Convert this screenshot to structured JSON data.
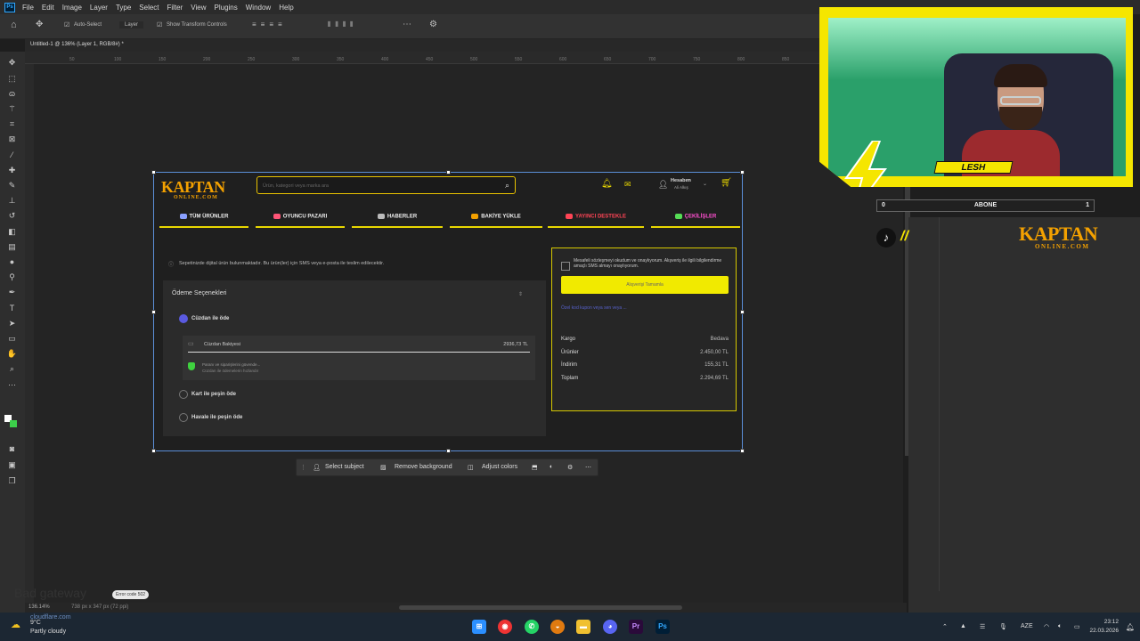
{
  "photoshop": {
    "menus": [
      "File",
      "Edit",
      "Image",
      "Layer",
      "Type",
      "Select",
      "Filter",
      "View",
      "Plugins",
      "Window",
      "Help"
    ],
    "options": {
      "auto_select": "Auto-Select",
      "layer": "Layer",
      "transform": "Show Transform Controls"
    },
    "doc_tab": "Untitled-1 @ 136% (Layer 1, RGB/8#) *",
    "ruler_ticks": [
      "50",
      "100",
      "150",
      "200",
      "250",
      "300",
      "350",
      "400",
      "450",
      "500",
      "550",
      "600",
      "650",
      "700",
      "750",
      "800",
      "850"
    ],
    "status": {
      "zoom": "136.14%",
      "size": "738 px x 347 px (72 ppi)"
    },
    "context_bar": {
      "select_subject": "Select subject",
      "remove_bg": "Remove background",
      "adjust": "Adjust colors"
    }
  },
  "site": {
    "logo": "KAPTAN",
    "logo_sub": "ONLINE.COM",
    "search_placeholder": "Ürün, kategori veya marka ara",
    "account": "Hesabım",
    "account_sub": "Ali Alkış",
    "nav": [
      {
        "label": "TÜM ÜRÜNLER",
        "color": "#8aa0ff"
      },
      {
        "label": "OYUNCU PAZARI",
        "color": "#ff5577"
      },
      {
        "label": "HABERLER",
        "color": "#bbbbbb"
      },
      {
        "label": "BAKİYE YÜKLE",
        "color": "#f4a100"
      },
      {
        "label": "YAYINCI DESTEKLE",
        "color": "#ff4455"
      },
      {
        "label": "ÇEKİLİŞLER",
        "color": "#55dd55"
      }
    ],
    "notice": "Sepetinizde dijital ürün bulunmaktadır. Bu ürün(ler) için SMS veya e-posta ile teslim edilecektir.",
    "payment_title": "Ödeme Seçenekleri",
    "options": [
      {
        "label": "Cüzdan ile öde"
      },
      {
        "label": "Kart ile peşin öde"
      },
      {
        "label": "Havale ile peşin öde"
      }
    ],
    "wallet_balance_label": "Cüzdan Bakiyesi",
    "wallet_balance_value": "2936,73 TL",
    "wallet_hint": "Paranı ve siparişlerini güvende...",
    "wallet_hint_sub": "Cüzdan ile ödemelerin hızlandır",
    "terms": "Mesafeli sözleşmeyi okudum ve onaylıyorum. Alışveriş ile ilgili bilgilendirme amaçlı SMS almayı onaylıyorum.",
    "confirm_button": "Alışverişi Tamamla",
    "promo": "Özel kod kupon veya sen veya ...",
    "summary": [
      {
        "label": "Kargo",
        "value": "Bedava"
      },
      {
        "label": "Ürünler",
        "value": "2.450,00 TL"
      },
      {
        "label": "İndirim",
        "value": "155,31 TL"
      },
      {
        "label": "Toplam",
        "value": "2.294,69 TL"
      }
    ]
  },
  "stream": {
    "name": "LESH",
    "abone_label": "ABONE",
    "abone_left": "0",
    "abone_right": "1",
    "logo": "KAPTAN",
    "logo_sub": "ONLINE.COM"
  },
  "taskbar": {
    "weather": "Partly cloudy",
    "weather_temp": "9°C",
    "cloudflare": "cloudflare.com",
    "error_badge": "Error code 502",
    "faded_text": "Bad gateway",
    "lang": "AZE",
    "time": "23:12",
    "date": "22.03.2026"
  }
}
